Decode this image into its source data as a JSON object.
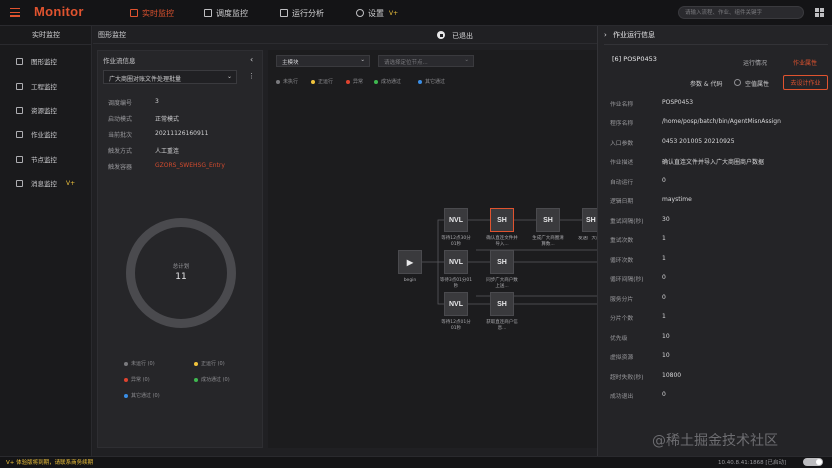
{
  "app": {
    "title": "Monitor"
  },
  "topnav": [
    {
      "label": "实时监控",
      "active": true
    },
    {
      "label": "调度监控",
      "active": false
    },
    {
      "label": "运行分析",
      "active": false
    },
    {
      "label": "设置",
      "active": false,
      "badge": "V+"
    }
  ],
  "search": {
    "placeholder": "请输入流程、作业、组件关键字"
  },
  "sidebar": {
    "title": "实时监控",
    "items": [
      {
        "label": "图形监控"
      },
      {
        "label": "工程监控"
      },
      {
        "label": "资源监控"
      },
      {
        "label": "作业监控"
      },
      {
        "label": "节点监控"
      },
      {
        "label": "消息监控",
        "badge": "V+"
      }
    ]
  },
  "subheader": {
    "title": "图形监控",
    "status": "已退出"
  },
  "job_panel": {
    "title": "作业流信息",
    "selected_job": "广大商圈对账文件处理批量",
    "fields": [
      {
        "key": "调度编号",
        "value": "3"
      },
      {
        "key": "启动模式",
        "value": "正常模式"
      },
      {
        "key": "当前批次",
        "value": "20211126160911"
      },
      {
        "key": "触发方式",
        "value": "人工重连"
      },
      {
        "key": "触发容器",
        "value": "GZORS_SWEHSG_Entry"
      }
    ],
    "ring": {
      "label": "总计划",
      "value": "11"
    },
    "legend": [
      {
        "label": "未运行 (0)",
        "color": "#7a7a7e"
      },
      {
        "label": "正运行 (0)",
        "color": "#f0c33c"
      },
      {
        "label": "异常 (0)",
        "color": "#e0432f"
      },
      {
        "label": "成功通过 (0)",
        "color": "#3fb950"
      },
      {
        "label": "其它通过 (0)",
        "color": "#3a8ee6"
      }
    ]
  },
  "graph": {
    "module_select": "主模块",
    "node_select_placeholder": "请选择定位节点...",
    "status_legend": [
      {
        "label": "未执行",
        "color": "#7a7a7e"
      },
      {
        "label": "正运行",
        "color": "#f0c33c"
      },
      {
        "label": "异常",
        "color": "#e0432f"
      },
      {
        "label": "成功通过",
        "color": "#3fb950"
      },
      {
        "label": "其它通过",
        "color": "#3a8ee6"
      }
    ],
    "begin_label": "begin",
    "nodes": [
      {
        "type": "NVL",
        "label": "等待12点30分01秒"
      },
      {
        "type": "SH",
        "label": "确认直连文件并导入..."
      },
      {
        "type": "SH",
        "label": "生成广大商圈清算数..."
      },
      {
        "type": "SH",
        "label": "发送广大商圈清算..."
      },
      {
        "type": "NVL",
        "label": "等待3点01分01秒"
      },
      {
        "type": "SH",
        "label": "同步广大商户数上送..."
      },
      {
        "type": "NVL",
        "label": "等待12点01分01秒"
      },
      {
        "type": "SH",
        "label": "获取直连商户信息..."
      }
    ]
  },
  "right_panel": {
    "title": "作业运行信息",
    "job_id": "[6] POSP0453",
    "tabs": [
      {
        "label": "运行情况",
        "active": false
      },
      {
        "label": "作业属性",
        "active": true
      }
    ],
    "sub_tab": "参数 & 代码",
    "checkbox_label": "空值属性",
    "action_button": "去设计作业",
    "fields": [
      {
        "key": "作业名称",
        "value": "POSP0453"
      },
      {
        "key": "程序名称",
        "value": "/home/posp/batch/bin/AgentMisnAssign"
      },
      {
        "key": "入口参数",
        "value": "0453 201005 20210925"
      },
      {
        "key": "作业描述",
        "value": "确认直连文件并导入广大商圈商户数据"
      },
      {
        "key": "自动运行",
        "value": "0"
      },
      {
        "key": "逻辑日期",
        "value": "maystime"
      },
      {
        "key": "重试间隔(秒)",
        "value": "30"
      },
      {
        "key": "重试次数",
        "value": "1"
      },
      {
        "key": "循环次数",
        "value": "1"
      },
      {
        "key": "循环间隔(秒)",
        "value": "0"
      },
      {
        "key": "服务分片",
        "value": "0"
      },
      {
        "key": "分片个数",
        "value": "1"
      },
      {
        "key": "优先级",
        "value": "10"
      },
      {
        "key": "虚拟资源",
        "value": "10"
      },
      {
        "key": "超时失败(秒)",
        "value": "10800"
      },
      {
        "key": "成功退出",
        "value": "0"
      }
    ]
  },
  "bottombar": {
    "notice": "V+ 体验版将到期，请联系商务续期",
    "right_status": "10.40.8.41:1868 [已启动]"
  },
  "watermark": "@稀土掘金技术社区"
}
